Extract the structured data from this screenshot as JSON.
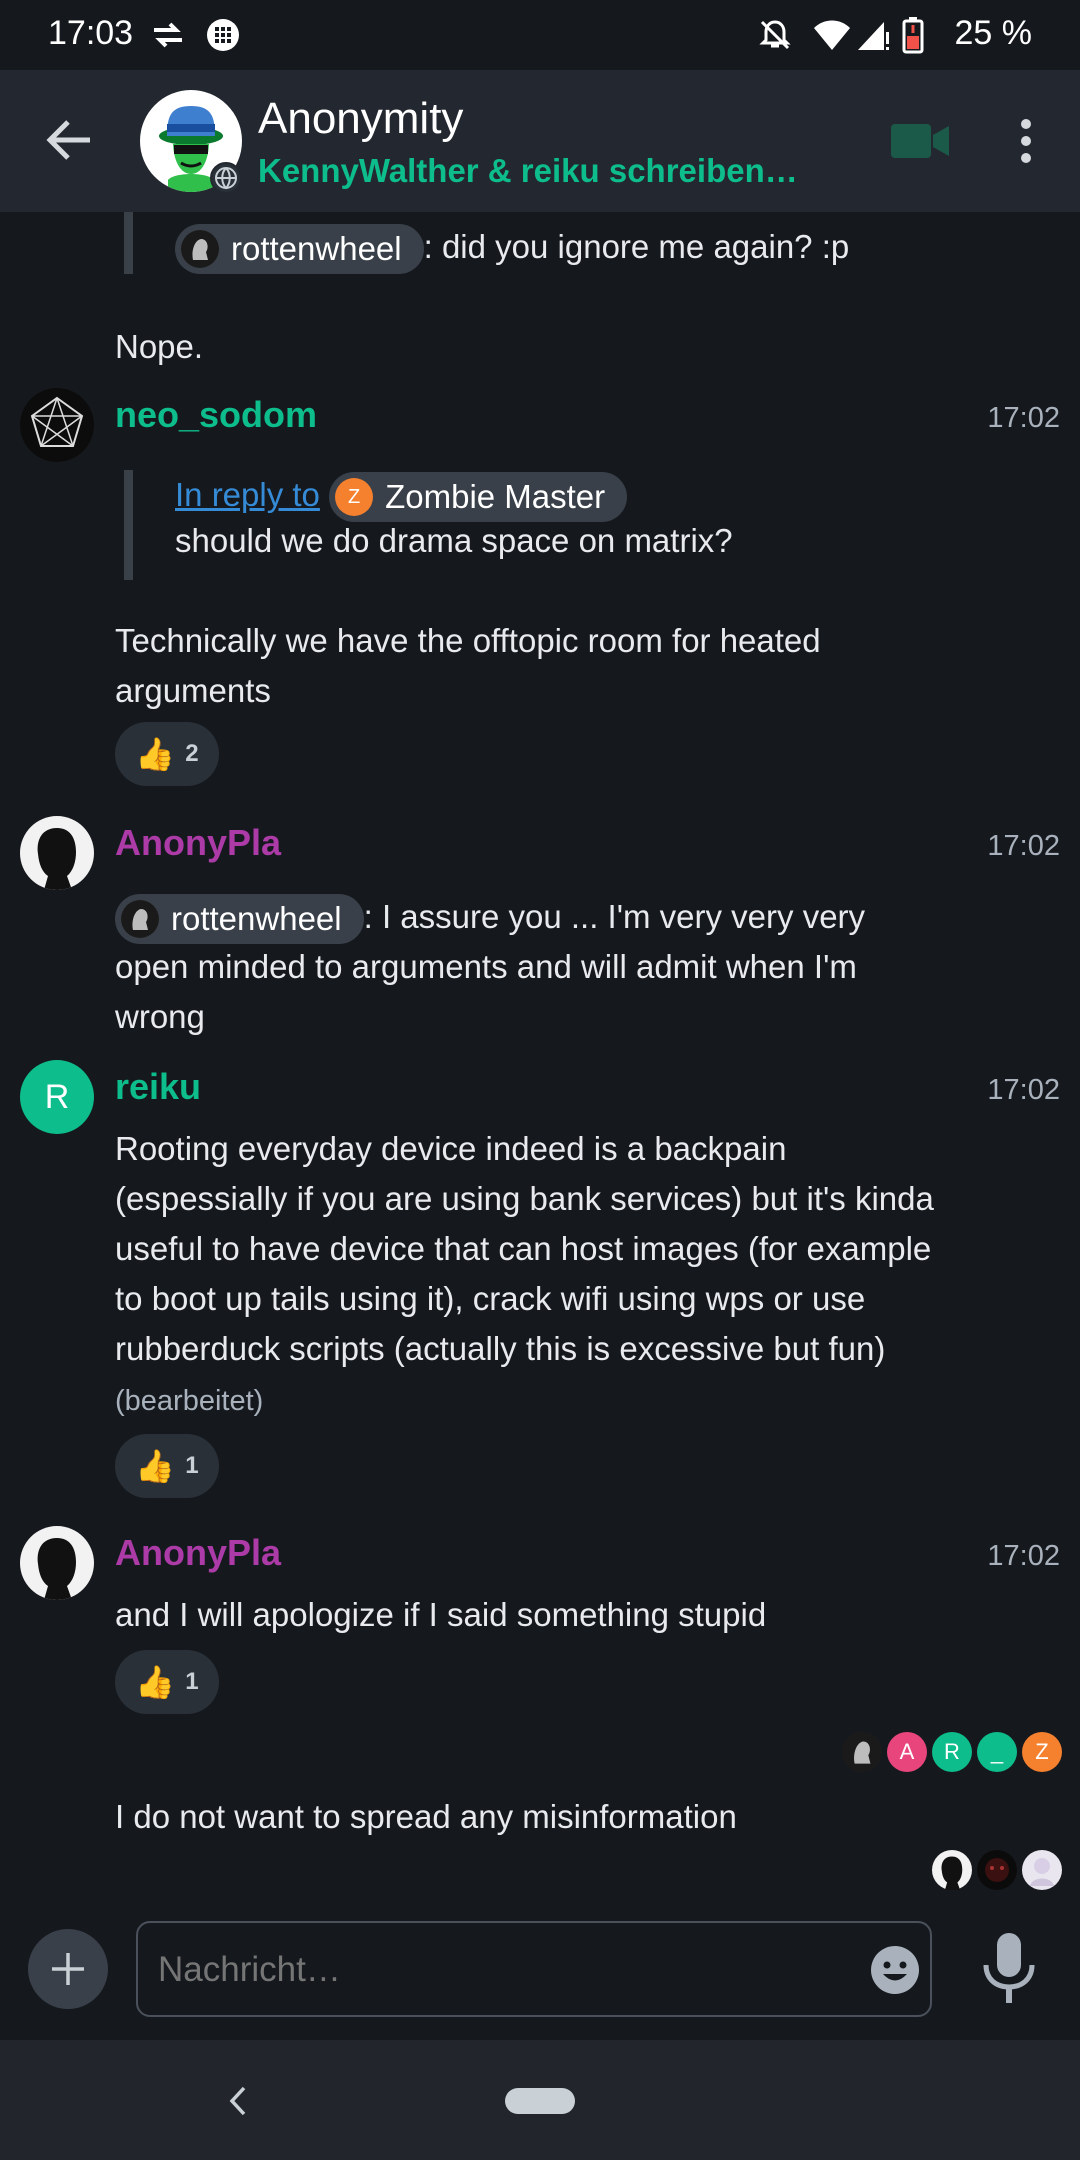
{
  "status_bar": {
    "time": "17:03",
    "battery": "25 %"
  },
  "header": {
    "title": "Anonymity",
    "subtitle": "KennyWalther & reiku schreiben…"
  },
  "timeline": {
    "prev_quote": {
      "mention": "rottenwheel",
      "text": ": did you ignore me again? :p"
    },
    "prev_reply": "Nope.",
    "m1": {
      "sender": "neo_sodom",
      "time": "17:02",
      "reply_link": "In reply to",
      "reply_user": "Zombie Master",
      "reply_user_initial": "Z",
      "reply_text": "should we do drama space on matrix?",
      "text": "Technically we have the offtopic room for heated arguments",
      "reaction_emoji": "👍",
      "reaction_count": "2"
    },
    "m2": {
      "sender": "AnonyPla",
      "time": "17:02",
      "mention": "rottenwheel",
      "text_after": ": I assure you ... I'm very very very",
      "text_rest": "open minded to arguments and will admit when I'm wrong"
    },
    "m3": {
      "sender": "reiku",
      "avatar_initial": "R",
      "time": "17:02",
      "text": "Rooting everyday device indeed is a backpain (espessially if you are using bank services) but it's kinda useful to have device that can host images (for example to boot up tails using it), crack wifi using wps or use rubberduck scripts (actually this is excessive but fun)",
      "edited": "(bearbeitet)",
      "reaction_emoji": "👍",
      "reaction_count": "1"
    },
    "m4": {
      "sender": "AnonyPla",
      "time": "17:02",
      "text": "and I will apologize if I said something stupid",
      "reaction_emoji": "👍",
      "reaction_count": "1",
      "read_receipts": [
        "A",
        "R",
        "_",
        "Z"
      ]
    },
    "m5": {
      "text": "I do not want to spread any misinformation"
    }
  },
  "composer": {
    "placeholder": "Nachricht…"
  },
  "colors": {
    "accent": "#0dbd8b",
    "purple": "#ac3ba8",
    "orange": "#f5802e",
    "pink": "#e8457c",
    "link": "#368bd6"
  }
}
